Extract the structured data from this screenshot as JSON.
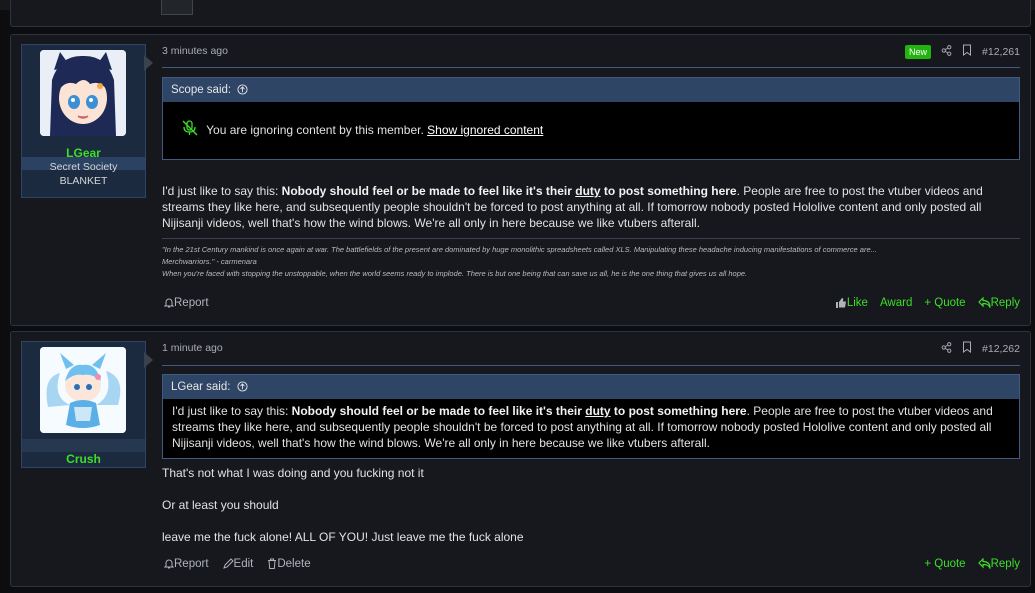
{
  "post1": {
    "username": "LGear",
    "user_title": "Secret Society",
    "user_banner": "BLANKET",
    "date": "3 minutes ago",
    "new_badge": "New",
    "post_number": "#12,261",
    "quote_author": "Scope said:",
    "ignored_text": "You are ignoring content by this member.",
    "show_ignored": "Show ignored content",
    "body_pre": "I'd just like to say this: ",
    "body_bold1": "Nobody should feel or be made to feel like it's their ",
    "body_bold_u": "duty",
    "body_bold2": " to post something here",
    "body_post": ". People are free to post the vtuber videos and streams they like here, and subsequently people shouldn't be forced to post anything at all. If tomorrow nobody posted Hololive content and only posted all Nijisanji videos, well that's how the wind blows. We're all only in here because we like vtubers afterall.",
    "sig_line1": "\"In the 21st Century mankind is once again at war. The battlefields of the present are dominated by huge monolithic spreadsheets called XLS. Manipulating these headache inducing manifestations of commerce are...",
    "sig_line2": "Merchwarriors.\" - carmenara",
    "sig_line3": "When you're faced with stopping the unstoppable, when the world seems ready to implode. There is but one being that can save us all, he is the one thing that gives us all hope.",
    "report": "Report",
    "like": "Like",
    "award": "Award",
    "quote": "+ Quote",
    "reply": "Reply"
  },
  "post2": {
    "username": "Crush",
    "date": "1 minute ago",
    "post_number": "#12,262",
    "quote_author": "LGear said:",
    "quote_pre": "I'd just like to say this: ",
    "quote_bold1": "Nobody should feel or be made to feel like it's their ",
    "quote_bold_u": "duty",
    "quote_bold2": " to post something here",
    "quote_post": ". People are free to post the vtuber videos and streams they like here, and subsequently people shouldn't be forced to post anything at all. If tomorrow nobody posted Hololive content and only posted all Nijisanji videos, well that's how the wind blows. We're all only in here because we like vtubers afterall.",
    "line1": "That's not what I was doing and you fucking not it",
    "line2": "Or at least you should",
    "line3": "leave me the fuck alone! ALL OF YOU! Just leave me the fuck alone",
    "report": "Report",
    "edit": "Edit",
    "delete": "Delete",
    "quote": "+ Quote",
    "reply": "Reply"
  },
  "colors": {
    "accent_green": "#3dde2a",
    "quote_header": "#2f4566",
    "panel": "#16181d"
  }
}
